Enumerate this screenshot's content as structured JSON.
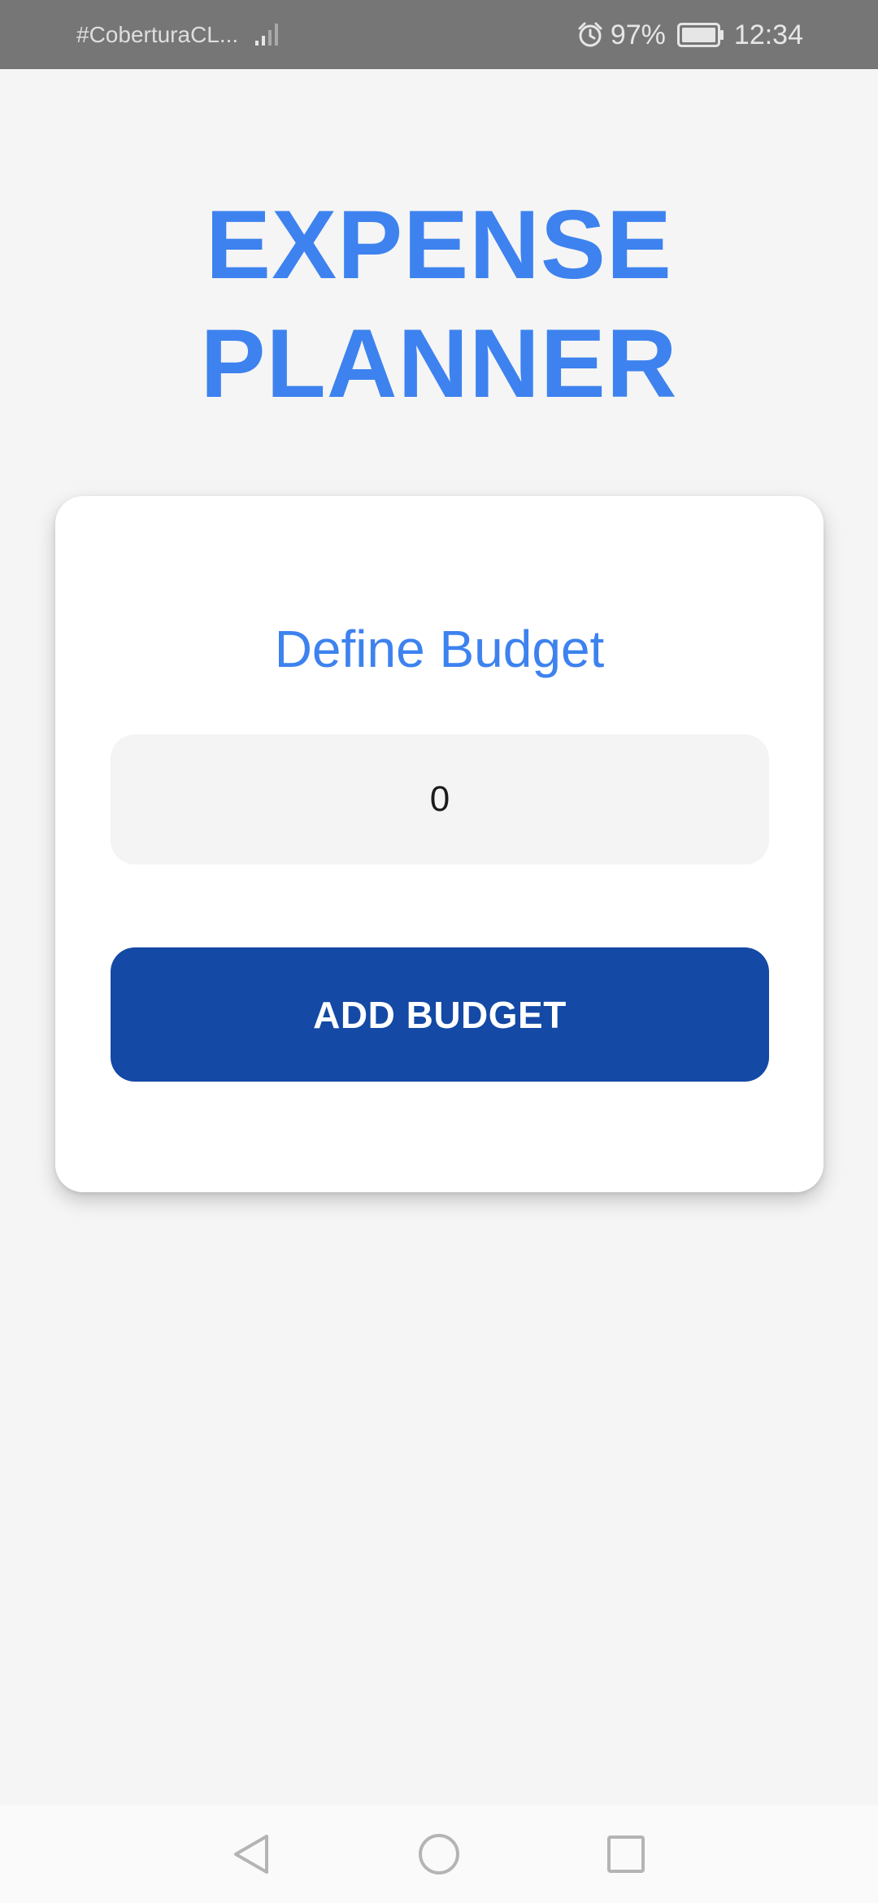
{
  "status_bar": {
    "carrier": "#CoberturaCL...",
    "battery": "97%",
    "time": "12:34",
    "icons": [
      "signal-icon",
      "alarm-icon",
      "battery-icon"
    ]
  },
  "app": {
    "title_line1": "EXPENSE",
    "title_line2": "PLANNER"
  },
  "card": {
    "heading": "Define Budget",
    "input_value": "0",
    "button_label": "ADD BUDGET"
  },
  "nav": {
    "icons": [
      "back-icon",
      "home-icon",
      "recents-icon"
    ]
  },
  "colors": {
    "accent": "#3d82ef",
    "button": "#1449a5",
    "status_bar": "#767676",
    "background": "#f5f5f5"
  }
}
